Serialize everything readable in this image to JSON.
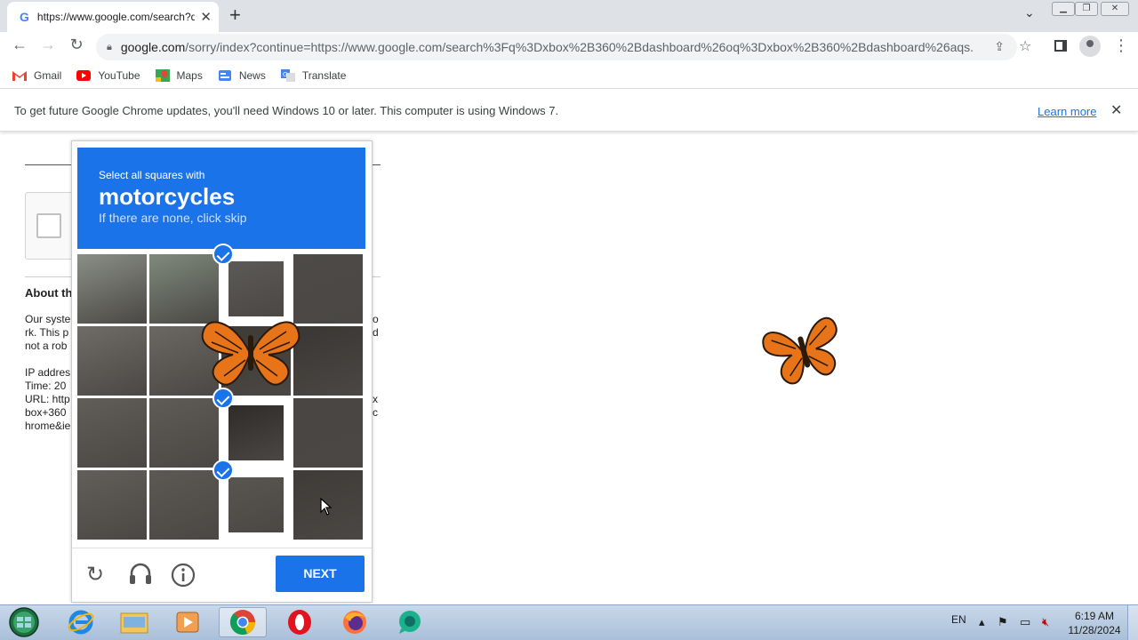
{
  "browser": {
    "tab_title": "https://www.google.com/search?q",
    "tab_icon": "G",
    "url_host": "google.com",
    "url_rest": "/sorry/index?continue=https://www.google.com/search%3Fq%3Dxbox%2B360%2Bdashboard%26oq%3Dxbox%2B360%2Bdashboard%26aqs..."
  },
  "bookmarks": [
    {
      "label": "Gmail"
    },
    {
      "label": "YouTube"
    },
    {
      "label": "Maps"
    },
    {
      "label": "News"
    },
    {
      "label": "Translate"
    }
  ],
  "infobar": {
    "message": "To get future Google Chrome updates, you'll need Windows 10 or later. This computer is using Windows 7.",
    "learn_more": "Learn more"
  },
  "page": {
    "about_heading": "About th",
    "lines_a": [
      "Our syste",
      "rk. This p",
      "not a rob"
    ],
    "lines_a_right": [
      "o",
      "d"
    ],
    "lines_b": [
      "IP addres",
      "Time: 20",
      "URL: http",
      "box+360",
      "hrome&ie"
    ],
    "lines_b_right": [
      "x",
      "c"
    ]
  },
  "captcha": {
    "instruction": "Select all squares with",
    "target": "motorcycles",
    "hint": "If there are none, click skip",
    "next_label": "NEXT",
    "selected_tiles": [
      2,
      10,
      14
    ]
  },
  "taskbar": {
    "lang": "EN",
    "time": "6:19 AM",
    "date": "11/28/2024"
  },
  "colors": {
    "captcha_blue": "#1a73e8",
    "butterfly": "#e8741a"
  }
}
